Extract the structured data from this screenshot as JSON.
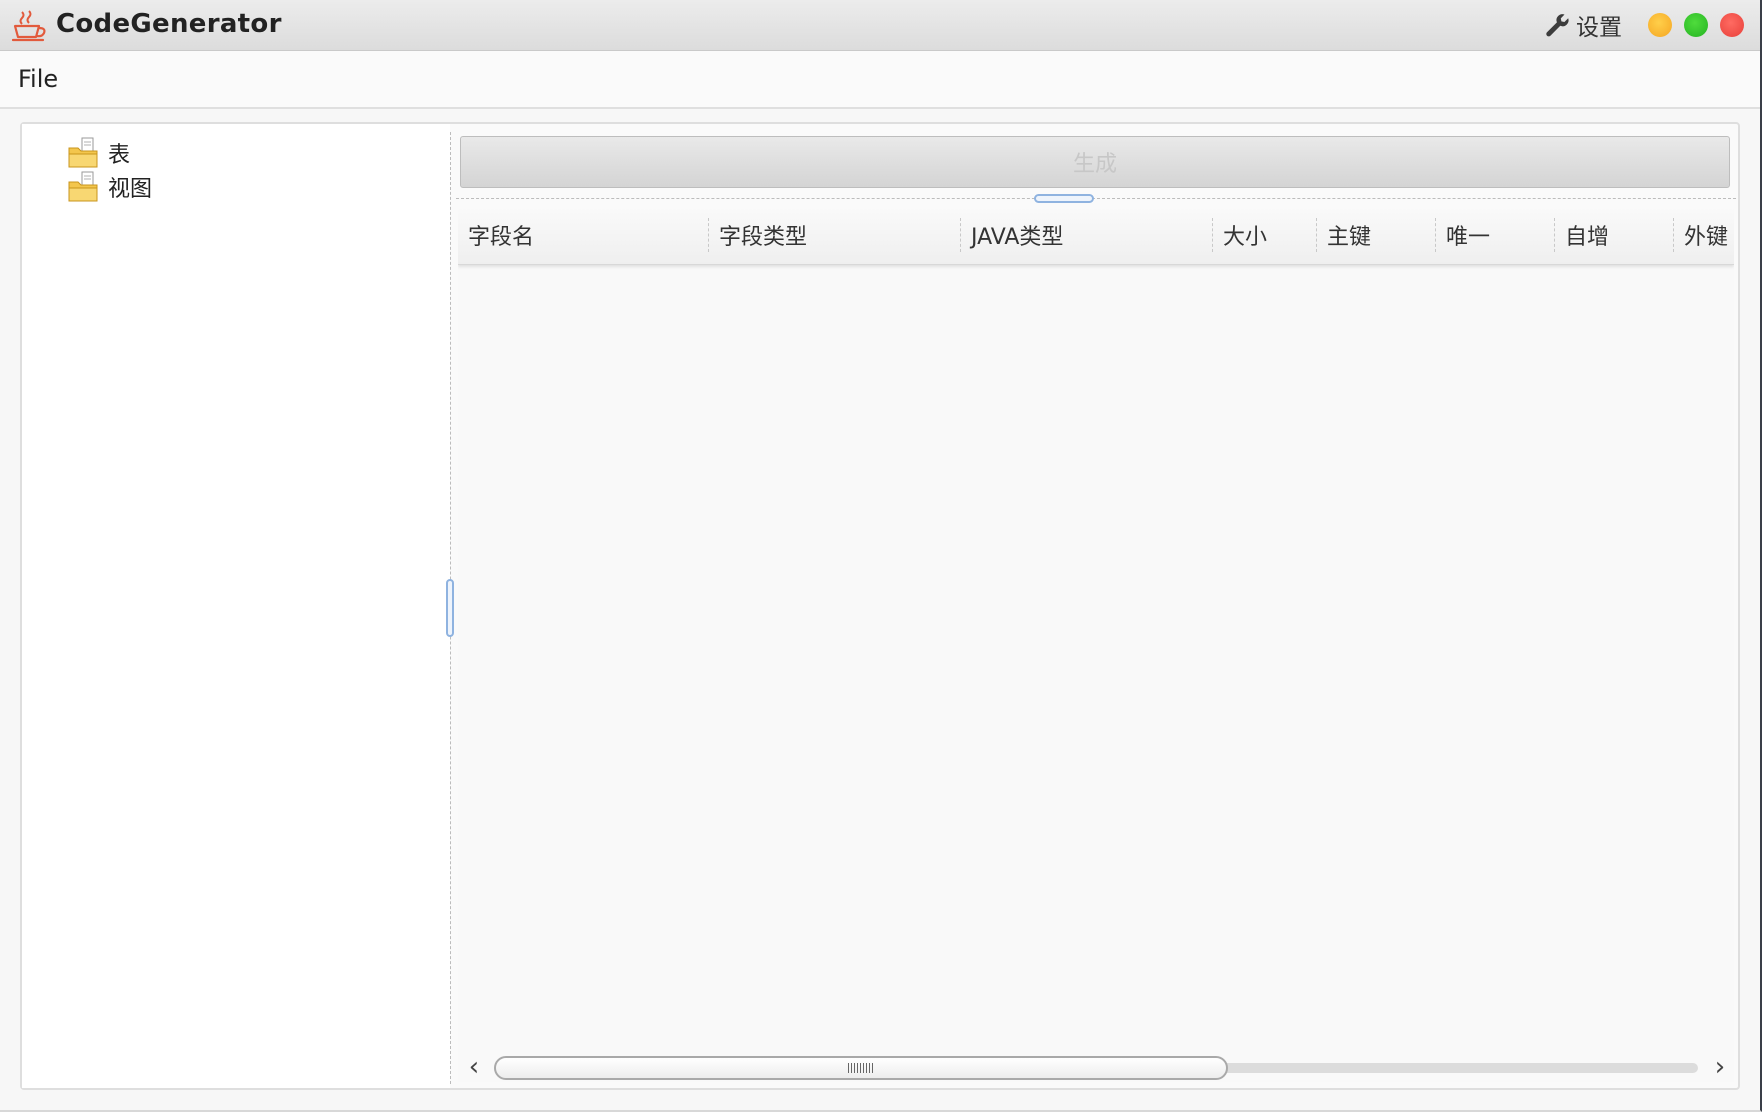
{
  "window": {
    "title": "CodeGenerator",
    "settings_label": "设置"
  },
  "icons": {
    "app": "coffee-cup-icon",
    "settings": "wrench-icon",
    "tree_node": "folder-icon"
  },
  "colors": {
    "minimize": "#f5a623",
    "maximize": "#25b323",
    "close": "#e8403a",
    "splitter_handle": "#8fb3e0"
  },
  "menubar": {
    "items": [
      {
        "label": "File"
      }
    ]
  },
  "tree": {
    "items": [
      {
        "label": "表"
      },
      {
        "label": "视图"
      }
    ]
  },
  "generate_button": {
    "label": "生成",
    "enabled": false
  },
  "table": {
    "columns": [
      {
        "label": "字段名"
      },
      {
        "label": "字段类型"
      },
      {
        "label": "JAVA类型"
      },
      {
        "label": "大小"
      },
      {
        "label": "主键"
      },
      {
        "label": "唯一"
      },
      {
        "label": "自增"
      },
      {
        "label": "外键"
      }
    ],
    "rows": []
  },
  "horizontal_scrollbar": {
    "visible_fraction": 0.61,
    "position_fraction": 0.0
  }
}
